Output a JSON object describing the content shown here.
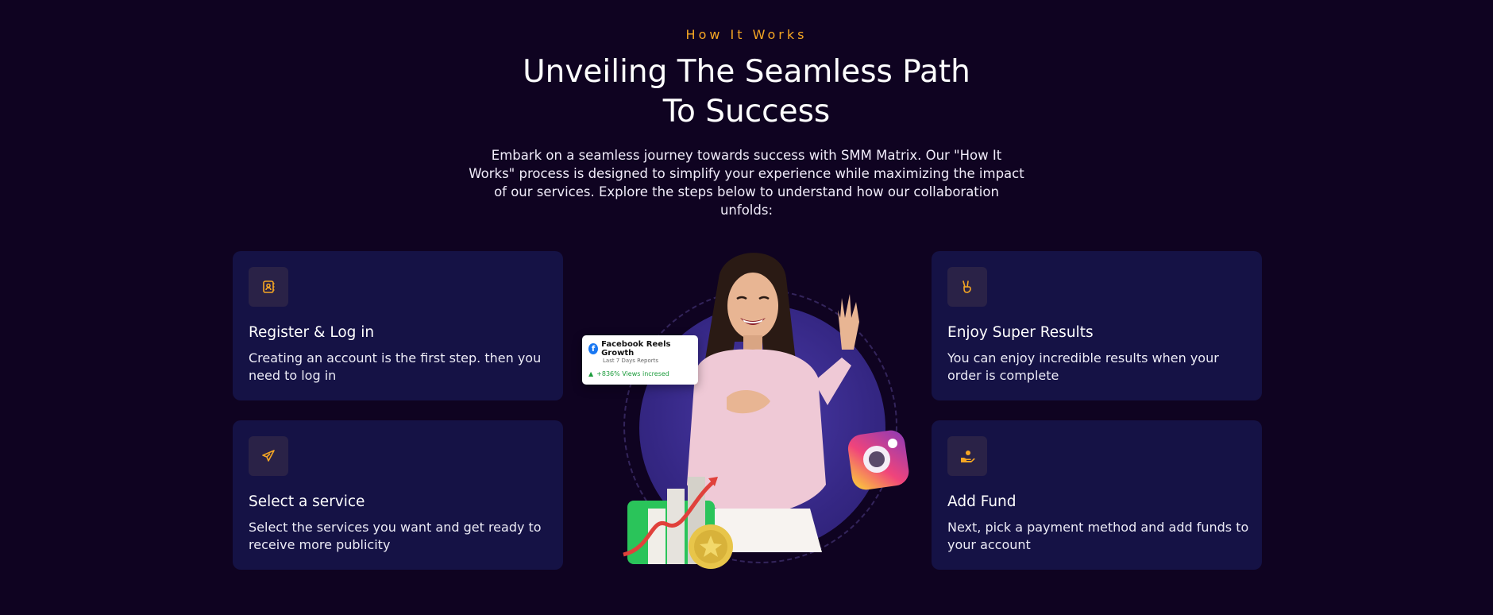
{
  "section": {
    "eyebrow": "How It Works",
    "title_line1": "Unveiling The Seamless Path",
    "title_line2": "To Success",
    "subtitle": "Embark on a seamless journey towards success with SMM Matrix. Our \"How It Works\" process is designed to simplify your experience while maximizing the impact of our services. Explore the steps below to understand how our collaboration unfolds:"
  },
  "steps": [
    {
      "icon": "contact-book-icon",
      "title": "Register & Log in",
      "text": "Creating an account is the first step. then you need to log in"
    },
    {
      "icon": "paper-plane-icon",
      "title": "Select a service",
      "text": "Select the services you want and get ready to receive more publicity"
    },
    {
      "icon": "victory-hand-icon",
      "title": "Enjoy Super Results",
      "text": "You can enjoy incredible results when your order is complete"
    },
    {
      "icon": "hand-coin-icon",
      "title": "Add Fund",
      "text": "Next, pick a payment method and add funds to your account"
    }
  ],
  "hero_badge": {
    "title": "Facebook Reels Growth",
    "subtitle": "Last 7 Days Reports",
    "stat": "+836% Views incresed"
  },
  "colors": {
    "background": "#0f0321",
    "card": "#151245",
    "accent": "#f5a623"
  }
}
